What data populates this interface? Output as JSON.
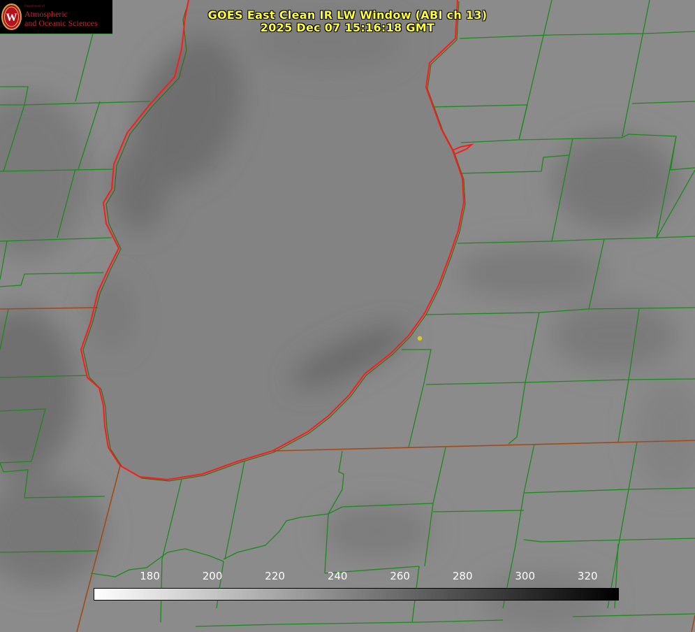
{
  "title_line1": "GOES East Clean IR LW Window (ABI ch 13)",
  "title_line2": "2025 Dec 07 15:16:18 GMT",
  "logo": {
    "department": "Department of",
    "line1": "Atmospheric",
    "line2": "and Oceanic Sciences",
    "seal_letter": "W"
  },
  "colorbar": {
    "ticks": [
      "180",
      "200",
      "220",
      "240",
      "260",
      "280",
      "300",
      "320"
    ],
    "min": 162,
    "max": 330,
    "colors": [
      "#ffffff",
      "#000000"
    ]
  },
  "colors": {
    "title": "#ffff33",
    "county_lines": "#1a8a1a",
    "state_lines": "#a04a18",
    "coastline": "#ff1a1a",
    "marker": "#d8cc1a"
  }
}
